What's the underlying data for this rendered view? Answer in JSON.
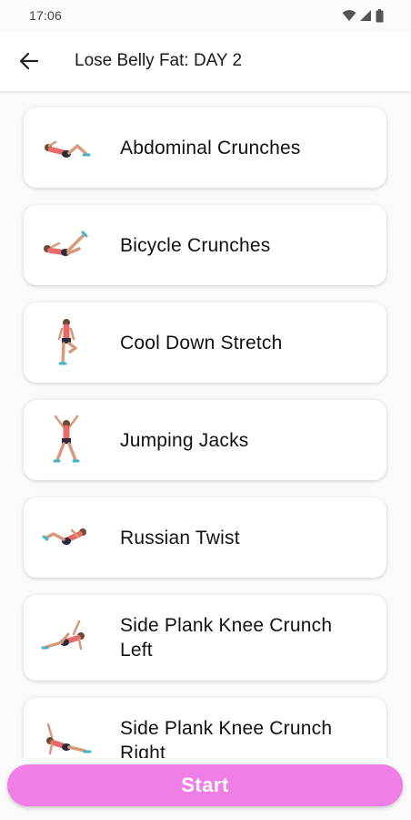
{
  "status_bar": {
    "time": "17:06",
    "icons": [
      "wifi-icon",
      "signal-icon",
      "battery-icon"
    ]
  },
  "app_bar": {
    "back_icon": "arrow-left-icon",
    "title": "Lose Belly Fat: DAY 2"
  },
  "exercises": [
    {
      "label": "Abdominal Crunches",
      "icon": "abdominal-crunches-figure-icon"
    },
    {
      "label": "Bicycle Crunches",
      "icon": "bicycle-crunches-figure-icon"
    },
    {
      "label": "Cool Down Stretch",
      "icon": "cool-down-stretch-figure-icon"
    },
    {
      "label": "Jumping Jacks",
      "icon": "jumping-jacks-figure-icon"
    },
    {
      "label": "Russian Twist",
      "icon": "russian-twist-figure-icon"
    },
    {
      "label": "Side Plank Knee Crunch Left",
      "icon": "side-plank-left-figure-icon"
    },
    {
      "label": "Side Plank Knee Crunch Right",
      "icon": "side-plank-right-figure-icon"
    }
  ],
  "start_button": {
    "label": "Start"
  },
  "colors": {
    "accent": "#ef7ee6",
    "skin": "#d89a7c",
    "outfit": "#e86a6a",
    "shorts": "#2a2a3a",
    "shoes": "#3fb6c9"
  }
}
